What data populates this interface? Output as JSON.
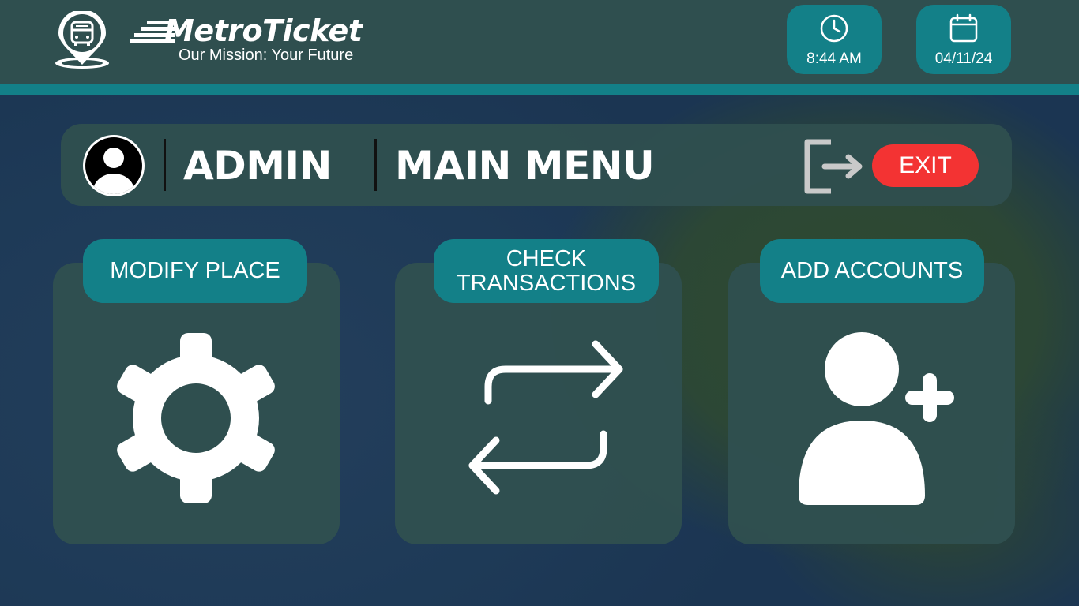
{
  "brand": {
    "name": "MetroTicket",
    "tagline": "Our Mission: Your Future",
    "logo_icon": "bus-location-pin-icon"
  },
  "status": {
    "time": "8:44 AM",
    "time_icon": "clock-icon",
    "date": "04/11/24",
    "date_icon": "calendar-icon"
  },
  "header": {
    "avatar_icon": "user-avatar-icon",
    "role": "ADMIN",
    "title": "MAIN MENU",
    "exit_icon": "sign-out-icon",
    "exit_label": "EXIT"
  },
  "menu": [
    {
      "label": "MODIFY PLACE",
      "icon": "gear-icon"
    },
    {
      "label": "CHECK TRANSACTIONS",
      "icon": "swap-arrows-icon"
    },
    {
      "label": "ADD ACCOUNTS",
      "icon": "add-user-icon"
    }
  ],
  "colors": {
    "panel": "#2f4f4f",
    "accent_teal": "#138088",
    "exit_red": "#f33333",
    "text": "#ffffff"
  }
}
